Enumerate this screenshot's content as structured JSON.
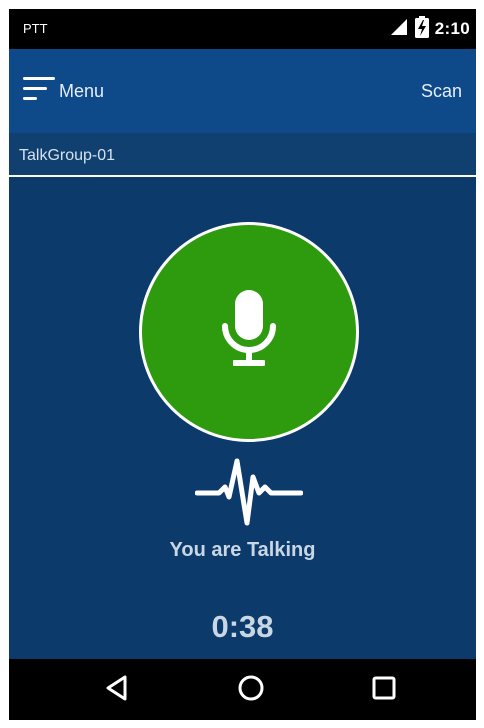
{
  "status_bar": {
    "app_label": "PTT",
    "time": "2:10",
    "icons": [
      "cell-signal-icon",
      "battery-charging-icon"
    ]
  },
  "app_bar": {
    "menu_label": "Menu",
    "scan_label": "Scan",
    "menu_icon": "hamburger-menu-icon"
  },
  "talkgroup": {
    "name": "TalkGroup-01"
  },
  "ptt": {
    "icon": "microphone-icon",
    "status": "You are Talking",
    "timer": "0:38",
    "wave_icon": "audio-wave-icon"
  },
  "nav_bar": {
    "items": [
      "back-icon",
      "home-icon",
      "recents-icon"
    ]
  },
  "colors": {
    "status_bar_bg": "#000000",
    "app_bar_bg": "#0e4a8a",
    "group_bar_bg": "#10406f",
    "main_bg": "#0b3a6b",
    "ptt_green": "#2e9b0f",
    "text_light": "#c9d6e4"
  }
}
